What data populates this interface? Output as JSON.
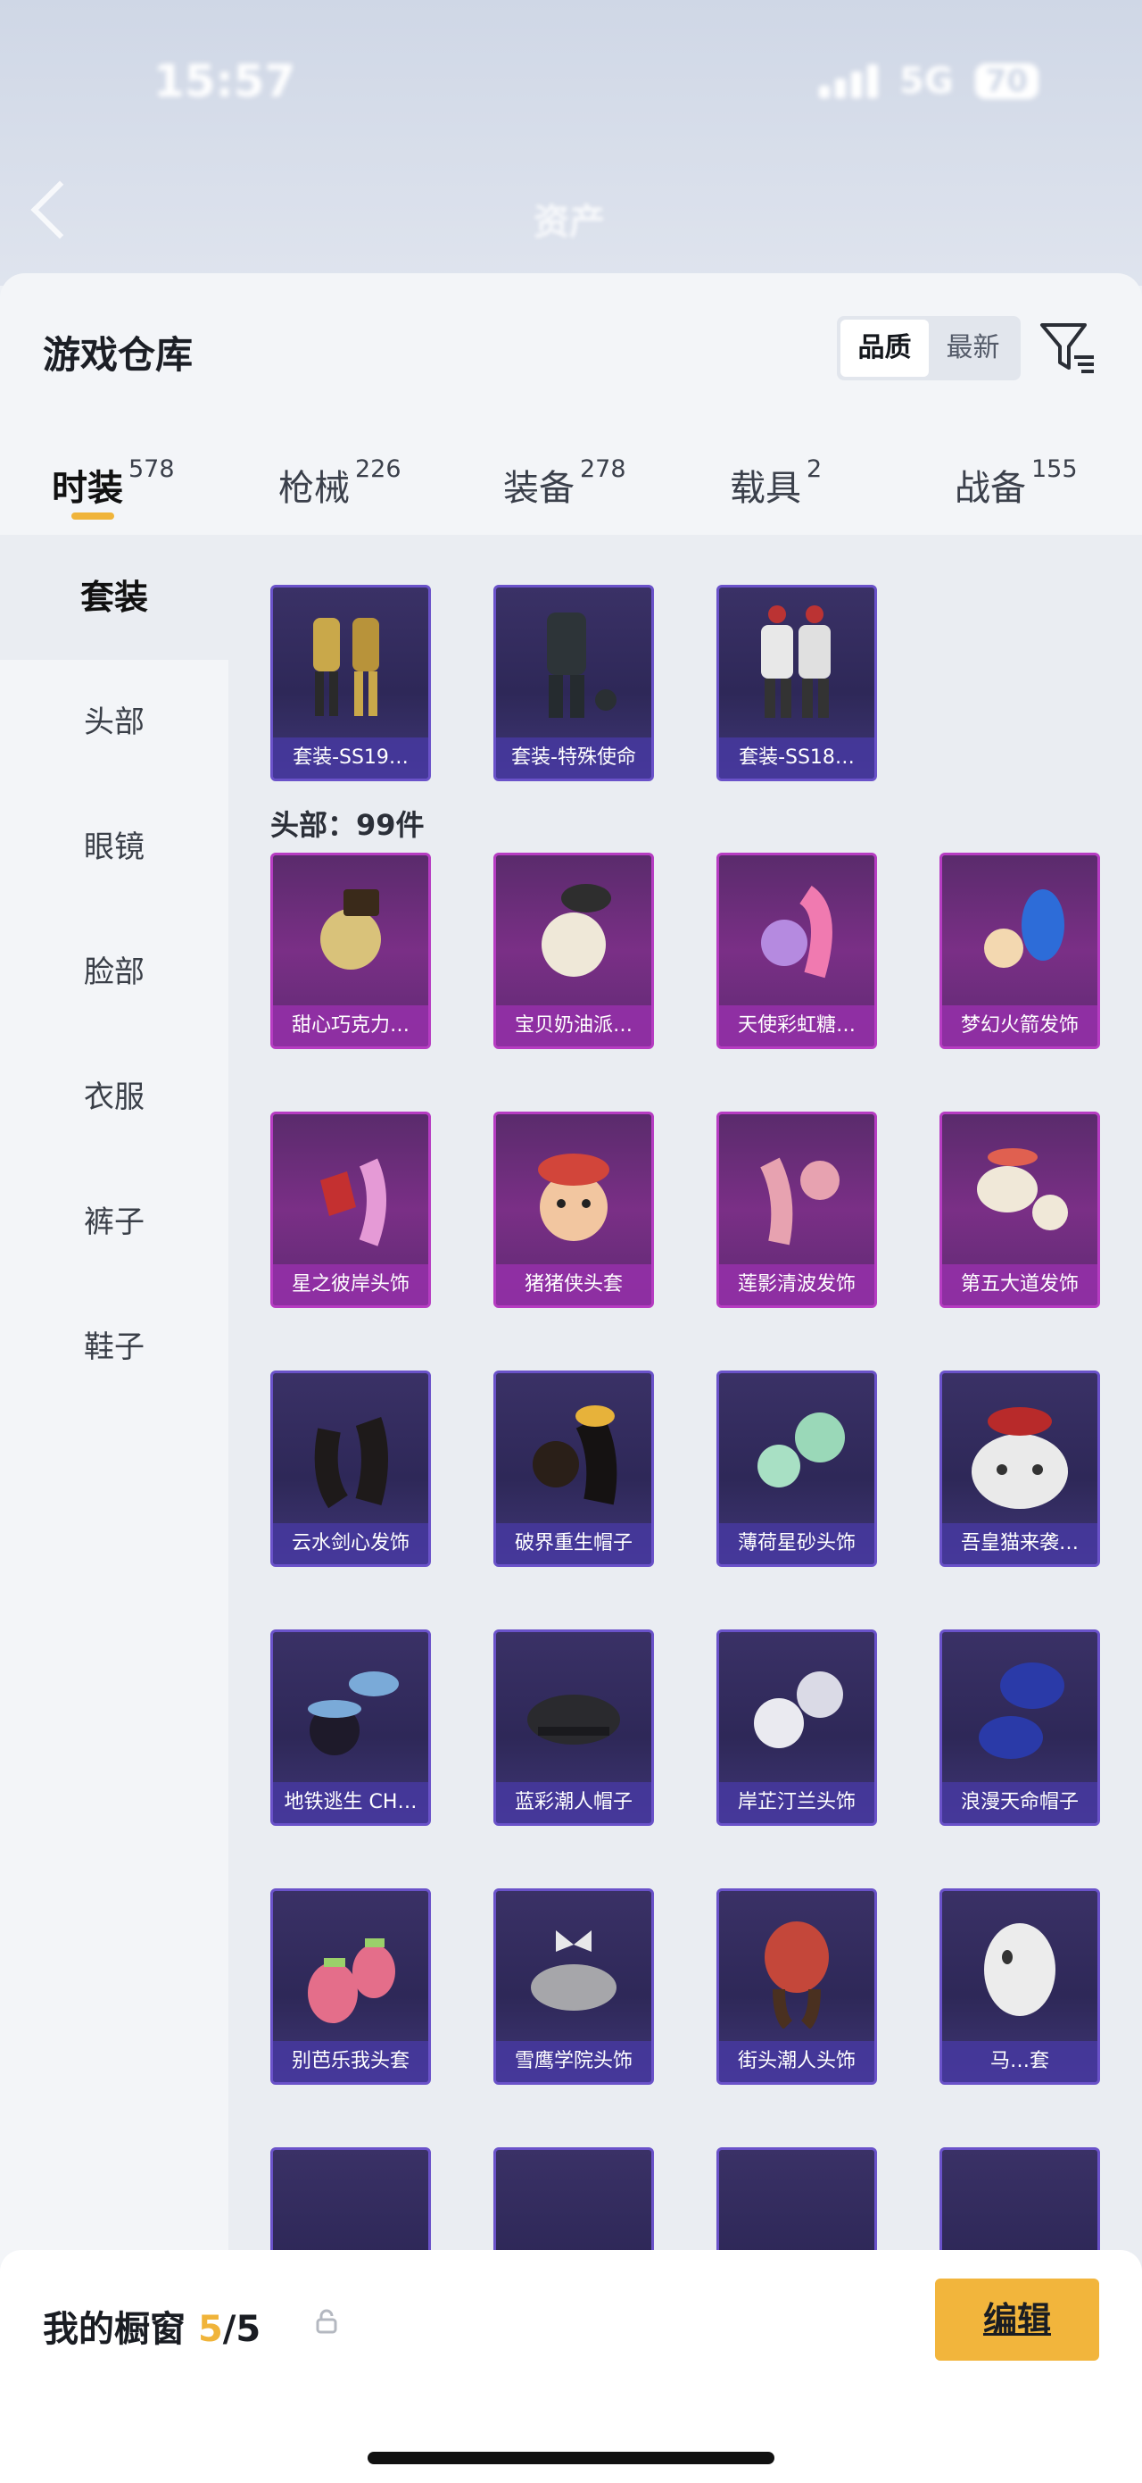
{
  "status_bar": {
    "time": "15:57",
    "network": "5G",
    "battery": "70"
  },
  "background": {
    "title": "资产"
  },
  "header": {
    "title": "游戏仓库",
    "sort_options": [
      "品质",
      "最新"
    ],
    "sort_active": "品质"
  },
  "tabs": [
    {
      "label": "时装",
      "count": "578",
      "active": true
    },
    {
      "label": "枪械",
      "count": "226"
    },
    {
      "label": "装备",
      "count": "278"
    },
    {
      "label": "载具",
      "count": "2"
    },
    {
      "label": "战备",
      "count": "155"
    }
  ],
  "sidebar": [
    {
      "label": "套装",
      "active": true
    },
    {
      "label": "头部"
    },
    {
      "label": "眼镜"
    },
    {
      "label": "脸部"
    },
    {
      "label": "衣服"
    },
    {
      "label": "裤子"
    },
    {
      "label": "鞋子"
    }
  ],
  "suits": [
    "套装-SS19…",
    "套装-特殊使命",
    "套装-SS18…"
  ],
  "head_section": {
    "label": "头部：99件"
  },
  "head_items": [
    "甜心巧克力…",
    "宝贝奶油派…",
    "天使彩虹糖…",
    "梦幻火箭发饰",
    "星之彼岸头饰",
    "猪猪侠头套",
    "莲影清波发饰",
    "第五大道发饰",
    "云水剑心发饰",
    "破界重生帽子",
    "薄荷星砂头饰",
    "吾皇猫来袭…",
    "地铁逃生 CH…",
    "蓝彩潮人帽子",
    "岸芷汀兰头饰",
    "浪漫天命帽子",
    "别芭乐我头套",
    "雪鹰学院头饰",
    "街头潮人头饰",
    "马…套"
  ],
  "bottom_bar": {
    "label": "我的橱窗",
    "current": "5",
    "total": "/5",
    "edit_label": "编辑"
  }
}
